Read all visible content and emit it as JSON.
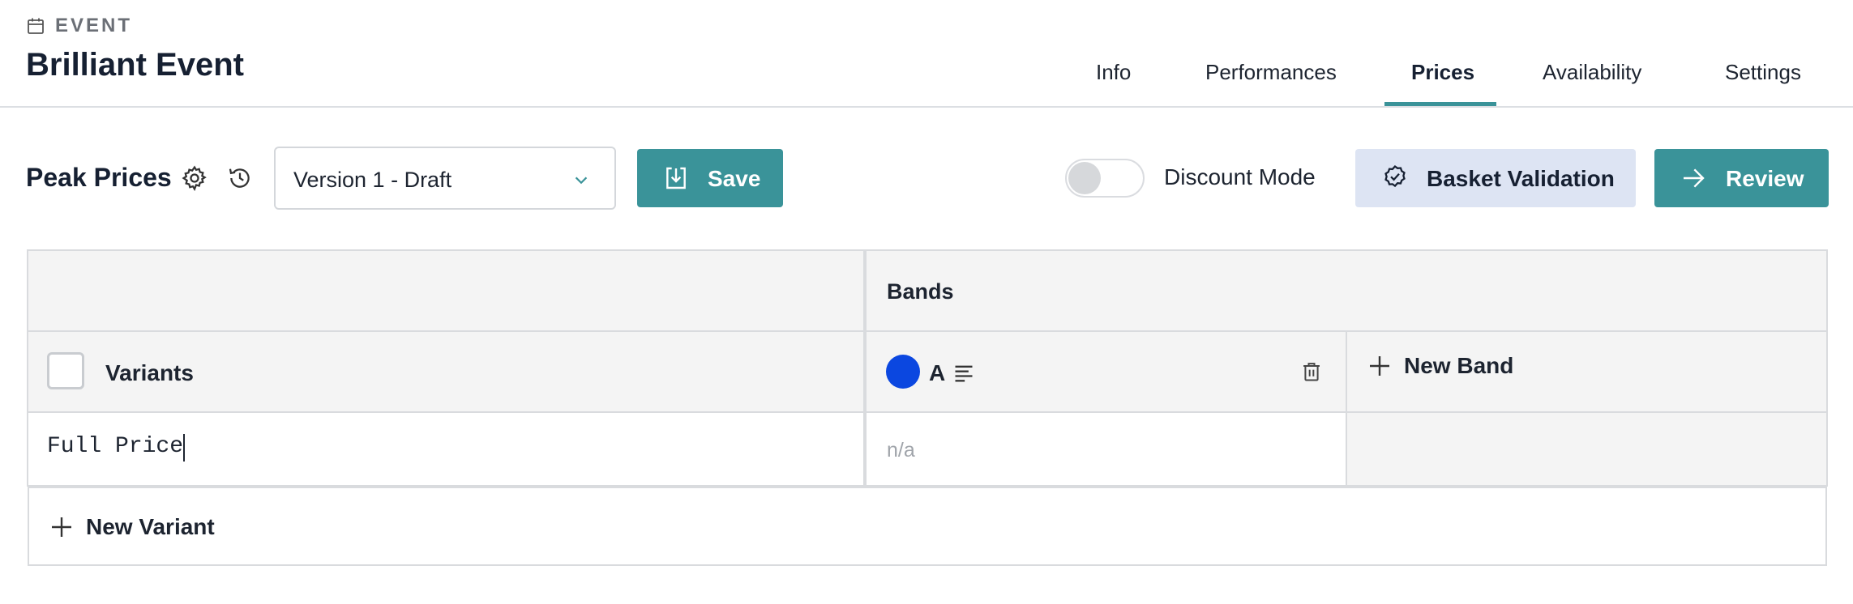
{
  "header": {
    "eyebrow": "EVENT",
    "title": "Brilliant Event",
    "tabs": [
      {
        "label": "Info",
        "active": false
      },
      {
        "label": "Performances",
        "active": false
      },
      {
        "label": "Prices",
        "active": true
      },
      {
        "label": "Availability",
        "active": false
      },
      {
        "label": "Settings",
        "active": false
      }
    ]
  },
  "toolbar": {
    "title": "Peak Prices",
    "version_value": "Version 1 - Draft",
    "save_label": "Save",
    "discount_mode_label": "Discount Mode",
    "discount_mode_on": false,
    "basket_validation_label": "Basket Validation",
    "review_label": "Review"
  },
  "grid": {
    "bands_header": "Bands",
    "variants_header": "Variants",
    "band": {
      "name": "A",
      "color": "#0b47e0"
    },
    "new_band_label": "New Band",
    "variant_row": {
      "value": "Full Price",
      "band_value": "n/a"
    },
    "new_variant_label": "New Variant"
  },
  "colors": {
    "accent": "#3a9399",
    "basket_bg": "#dde4f3",
    "band_blue": "#0b47e0"
  }
}
